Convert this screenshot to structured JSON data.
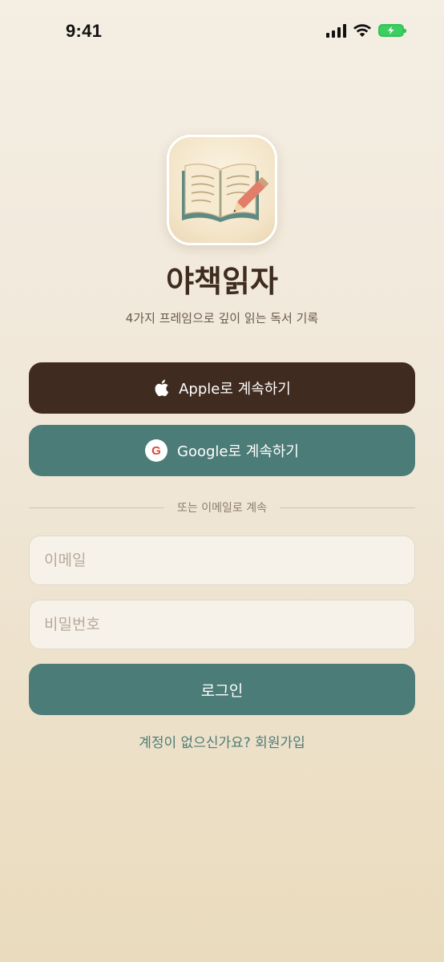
{
  "status_bar": {
    "time": "9:41"
  },
  "app": {
    "title": "야책읽자",
    "subtitle": "4가지 프레임으로 깊이 읽는 독서 기록",
    "icon": "book-with-pencil-icon"
  },
  "auth": {
    "apple_label": "Apple로 계속하기",
    "apple_icon": "apple-logo-icon",
    "google_label": "Google로 계속하기",
    "google_icon_letter": "G",
    "divider_text": "또는 이메일로 계속",
    "email_placeholder": "이메일",
    "password_placeholder": "비밀번호",
    "login_label": "로그인",
    "signup_text": "계정이 없으신가요? 회원가입"
  },
  "colors": {
    "apple_button": "#3f2b20",
    "primary_teal": "#4c7c77",
    "background": "#f0e7d8"
  }
}
